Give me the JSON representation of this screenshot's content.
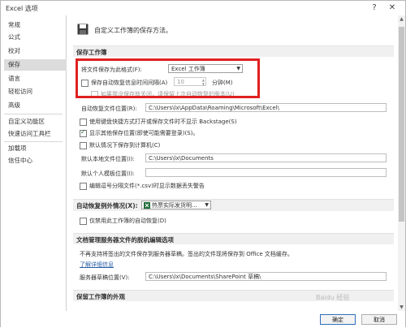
{
  "window": {
    "title": "Excel 选项",
    "help_glyph": "?",
    "close_glyph": "✕"
  },
  "sidebar": {
    "items": [
      {
        "label": "常规"
      },
      {
        "label": "公式"
      },
      {
        "label": "校对"
      },
      {
        "label": "保存",
        "active": true
      },
      {
        "label": "语言"
      },
      {
        "label": "轻松访问"
      },
      {
        "label": "高级"
      },
      {
        "label": "自定义功能区"
      },
      {
        "label": "快速访问工具栏"
      },
      {
        "label": "加载项"
      },
      {
        "label": "信任中心"
      }
    ]
  },
  "main": {
    "header": "自定义工作簿的保存方法。",
    "save_section": {
      "title": "保存工作簿",
      "format_label": "将文件保存为此格式(F):",
      "format_value": "Excel 工作簿",
      "autorecover_label": "保存自动恢复信息时间间隔(A)",
      "autorecover_checked": false,
      "autorecover_minutes": "10",
      "minutes_unit": "分钟(M)",
      "keep_last_label": "如果我没保存就关闭，请保留上次自动恢复的版本(U)",
      "autorecover_location_label": "自动恢复文件位置(R):",
      "autorecover_location_value": "C:\\Users\\lx\\AppData\\Roaming\\Microsoft\\Excel\\",
      "backstage_label": "使用键盘快捷方式打开或保存文件时不显示 Backstage(S)",
      "backstage_checked": false,
      "show_more_label": "显示其他保存位置(即使可能需要登录)(S)。",
      "show_more_checked": true,
      "default_computer_label": "默认情况下保存到计算机(C)",
      "default_computer_checked": false,
      "local_location_label": "默认本地文件位置(I):",
      "local_location_value": "C:\\Users\\lx\\Documents",
      "template_location_label": "默认个人模板位置(I):",
      "template_location_value": "",
      "csv_warning_label": "编辑逗号分隔文件(*.csv)时显示数据丢失警告",
      "csv_warning_checked": false
    },
    "exceptions_section": {
      "title": "自动恢复例外情况(X):",
      "workbook_value": "热票实际发货明...",
      "disable_label": "仅禁用此工作簿的自动恢复(D)",
      "disable_checked": false
    },
    "offline_section": {
      "title": "文档管理服务器文件的脱机编辑选项",
      "description": "不再支持将签出的文件保存到服务器草稿。签出的文件现将保存到 Office 文档缓存。",
      "learn_more": "了解详细信息",
      "drafts_label": "服务器草稿位置(V):",
      "drafts_value": "C:\\Users\\lx\\Documents\\SharePoint 草稿\\"
    },
    "appearance_section": {
      "title": "保留工作簿的外观"
    }
  },
  "footer": {
    "ok_label": "确定",
    "cancel_label": "取消"
  },
  "watermark": "Baidu 经验",
  "colors": {
    "highlight_box": "#e02020",
    "excel_green": "#1f6d3a",
    "link_blue": "#2a5fa8"
  }
}
